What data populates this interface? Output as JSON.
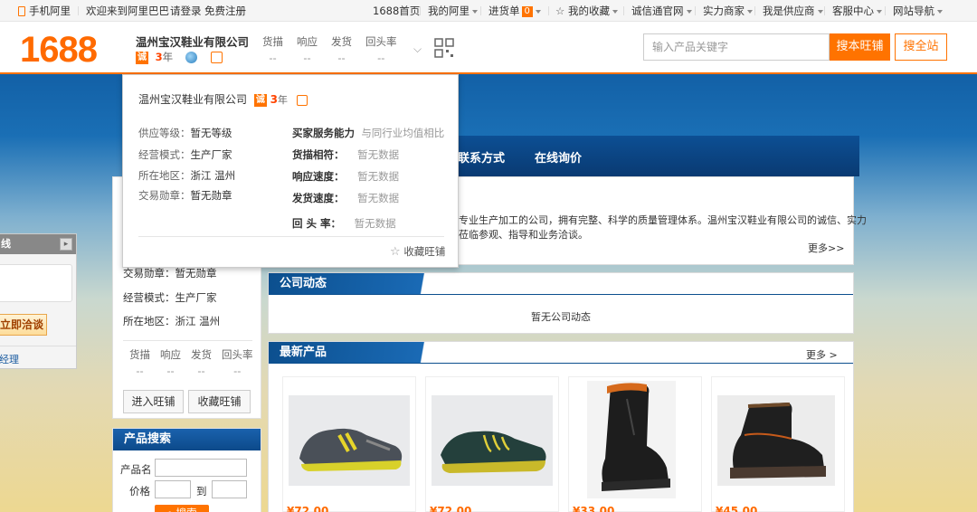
{
  "topbar": {
    "mobile": "手机阿里",
    "welcome": "欢迎来到阿里巴巴",
    "login": "请登录",
    "register": "免费注册",
    "home": "1688首页",
    "my_ali": "我的阿里",
    "cart": "进货单",
    "cart_count": "0",
    "favorites": "我的收藏",
    "chengxin": "诚信通官网",
    "merchants": "实力商家",
    "supplier": "我是供应商",
    "service": "客服中心",
    "sitenav": "网站导航"
  },
  "header": {
    "logo": "1688",
    "shop_name": "温州宝汉鞋业有限公司",
    "cheng": "诚",
    "years": "3",
    "year_unit": "年",
    "stats": [
      {
        "label": "货描",
        "value": "--"
      },
      {
        "label": "响应",
        "value": "--"
      },
      {
        "label": "发货",
        "value": "--"
      },
      {
        "label": "回头率",
        "value": "--"
      }
    ],
    "search_placeholder": "输入产品关键字",
    "search_store": "搜本旺铺",
    "search_site": "搜全站"
  },
  "nav": {
    "items": [
      "联系方式",
      "在线询价"
    ]
  },
  "popup": {
    "shop_name": "温州宝汉鞋业有限公司",
    "cheng": "诚",
    "years": "3",
    "year_unit": "年",
    "left": [
      {
        "label": "供应等级：",
        "value": "暂无等级"
      },
      {
        "label": "经营模式：",
        "value": "生产厂家"
      },
      {
        "label": "所在地区：",
        "value": "浙江 温州"
      },
      {
        "label": "交易勋章：",
        "value": "暂无勋章"
      }
    ],
    "ability_title": "买家服务能力",
    "ability_compare": "与同行业均值相比",
    "right": [
      {
        "label": "货描相符：",
        "value": "暂无数据"
      },
      {
        "label": "响应速度：",
        "value": "暂无数据"
      },
      {
        "label": "发货速度：",
        "value": "暂无数据"
      },
      {
        "label": "回 头 率：",
        "value": "暂无数据"
      }
    ],
    "favorite": "收藏旺铺"
  },
  "chat": {
    "title": "线",
    "button": "立即洽谈",
    "manager": "经理"
  },
  "sidebar": {
    "medal": "交易勋章：暂无勋章",
    "mode": "经营模式：生产厂家",
    "region": "所在地区：浙江 温州",
    "stats": [
      {
        "label": "货描",
        "value": "--"
      },
      {
        "label": "响应",
        "value": "--"
      },
      {
        "label": "发货",
        "value": "--"
      },
      {
        "label": "回头率",
        "value": "--"
      }
    ],
    "enter": "进入旺铺",
    "favorite": "收藏旺铺"
  },
  "product_search": {
    "title": "产品搜索",
    "name_label": "产品名",
    "price_label": "价格",
    "to": "到",
    "search": "搜索"
  },
  "intro": {
    "line1": "专业生产加工的公司，拥有完整、科学的质量管理体系。温州宝汉鞋业有限公司的诚信、实力",
    "line2": "莅临参观、指导和业务洽谈。",
    "more": "更多>>"
  },
  "company_news": {
    "title": "公司动态",
    "empty": "暂无公司动态"
  },
  "products": {
    "title": "最新产品",
    "more": "更多 >",
    "items": [
      {
        "price": "¥72.00"
      },
      {
        "price": "¥72.00"
      },
      {
        "price": "¥33.00"
      },
      {
        "price": "¥45.00"
      }
    ]
  }
}
